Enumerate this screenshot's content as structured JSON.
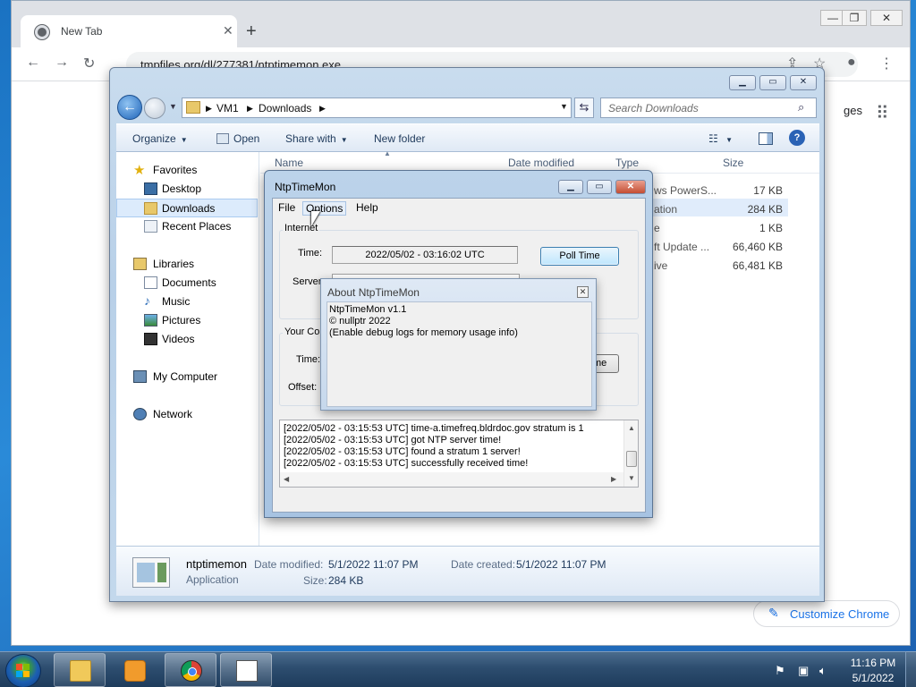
{
  "chrome": {
    "tab_title": "New Tab",
    "url": "tmpfiles.org/dl/277381/ntptimemon.exe",
    "right_text": "ges",
    "customize_label": "Customize Chrome"
  },
  "explorer": {
    "breadcrumb": [
      "VM1",
      "Downloads"
    ],
    "search_placeholder": "Search Downloads",
    "commands": {
      "organize": "Organize",
      "open": "Open",
      "share_with": "Share with",
      "new_folder": "New folder"
    },
    "nav": {
      "favorites": "Favorites",
      "desktop": "Desktop",
      "downloads": "Downloads",
      "recent_places": "Recent Places",
      "libraries": "Libraries",
      "documents": "Documents",
      "music": "Music",
      "pictures": "Pictures",
      "videos": "Videos",
      "my_computer": "My Computer",
      "network": "Network"
    },
    "columns": {
      "name": "Name",
      "date_modified": "Date modified",
      "type": "Type",
      "size": "Size"
    },
    "rows": [
      {
        "type": "ws PowerS...",
        "size": "17 KB"
      },
      {
        "type": "ation",
        "size": "284 KB"
      },
      {
        "type": "e",
        "size": "1 KB"
      },
      {
        "type": "ft Update ...",
        "size": "66,460 KB"
      },
      {
        "type": "ive",
        "size": "66,481 KB"
      }
    ],
    "details": {
      "name": "ntptimemon",
      "kind": "Application",
      "date_modified_label": "Date modified:",
      "date_modified": "5/1/2022 11:07 PM",
      "size_label": "Size:",
      "size": "284 KB",
      "date_created_label": "Date created:",
      "date_created": "5/1/2022 11:07 PM"
    }
  },
  "ntp": {
    "title": "NtpTimeMon",
    "menu": {
      "file": "File",
      "options": "Options",
      "help": "Help"
    },
    "internet_label": "Internet",
    "time_label": "Time:",
    "time_value": "2022/05/02 - 03:16:02 UTC",
    "server_label": "Server",
    "poll_button": "Poll Time",
    "your_label": "Your Co",
    "time_label_2": "Time:",
    "offset_label": "Offset:",
    "hidden_button": "me",
    "log": [
      "[2022/05/02 - 03:15:53 UTC] time-a.timefreq.bldrdoc.gov stratum is 1",
      "[2022/05/02 - 03:15:53 UTC] got NTP server time!",
      "[2022/05/02 - 03:15:53 UTC] found a stratum 1 server!",
      "[2022/05/02 - 03:15:53 UTC] successfully received time!"
    ]
  },
  "about": {
    "title": "About NtpTimeMon",
    "lines": [
      "NtpTimeMon v1.1",
      "© nullptr 2022",
      "(Enable debug logs for memory usage info)"
    ]
  },
  "taskbar": {
    "clock_time": "11:16 PM",
    "clock_date": "5/1/2022"
  }
}
